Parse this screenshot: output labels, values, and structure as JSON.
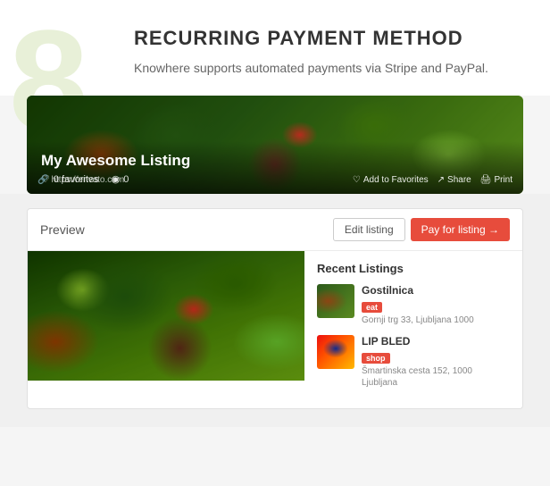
{
  "watermark": "8",
  "header": {
    "title": "RECURRING PAYMENT METHOD",
    "subtitle": "Knowhere supports automated payments via Stripe and PayPal."
  },
  "listing_banner": {
    "title": "My Awesome Listing",
    "favorites_count": "0 favorites",
    "views_count": "0",
    "url": "https://envato.com",
    "add_to_favorites": "Add to Favorites",
    "share": "Share",
    "print": "Print"
  },
  "preview_section": {
    "label": "Preview",
    "edit_button": "Edit listing",
    "pay_button": "Pay for listing →"
  },
  "recent_listings": {
    "title": "Recent Listings",
    "items": [
      {
        "name": "Gostilnica",
        "badge": "eat",
        "badge_type": "eat",
        "address": "Gornji trg 33, Ljubljana 1000"
      },
      {
        "name": "LIP BLED",
        "badge": "shop",
        "badge_type": "shop",
        "address": "Šmartinska cesta 152, 1000 Ljubljana"
      }
    ]
  }
}
